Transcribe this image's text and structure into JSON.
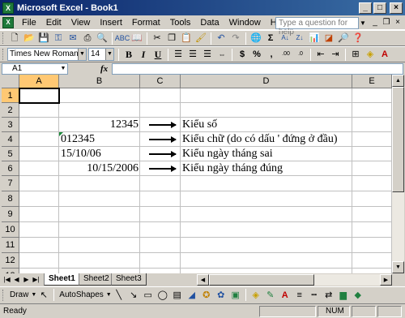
{
  "window": {
    "title": "Microsoft Excel - Book1",
    "app_icon": "excel-icon"
  },
  "menu": {
    "items": [
      "File",
      "Edit",
      "View",
      "Insert",
      "Format",
      "Tools",
      "Data",
      "Window",
      "Help"
    ],
    "help_placeholder": "Type a question for help"
  },
  "format": {
    "font_name": "Times New Roman",
    "font_size": "14"
  },
  "formula_bar": {
    "name_box": "A1",
    "fx_label": "fx",
    "content": ""
  },
  "columns": [
    "A",
    "B",
    "C",
    "D",
    "E"
  ],
  "rows": [
    "1",
    "2",
    "3",
    "4",
    "5",
    "6",
    "7",
    "8",
    "9",
    "10",
    "11",
    "12",
    "13"
  ],
  "cells": {
    "B3": "12345",
    "B4": "012345",
    "B5": "15/10/06",
    "B6": "10/15/2006",
    "D3": "Kiểu số",
    "D4": "Kiểu chữ (do có dấu ' đứng ở đầu)",
    "D5": "Kiểu ngày tháng sai",
    "D6": "Kiểu ngày tháng đúng"
  },
  "sheets": [
    "Sheet1",
    "Sheet2",
    "Sheet3"
  ],
  "active_sheet": "Sheet1",
  "draw_toolbar": {
    "draw_label": "Draw",
    "autoshapes_label": "AutoShapes"
  },
  "status": {
    "left": "Ready",
    "num": "NUM"
  },
  "colors": {
    "title_bar": "#0a246a",
    "selected_header": "#ffc873",
    "excel_green": "#1f7a3a"
  }
}
